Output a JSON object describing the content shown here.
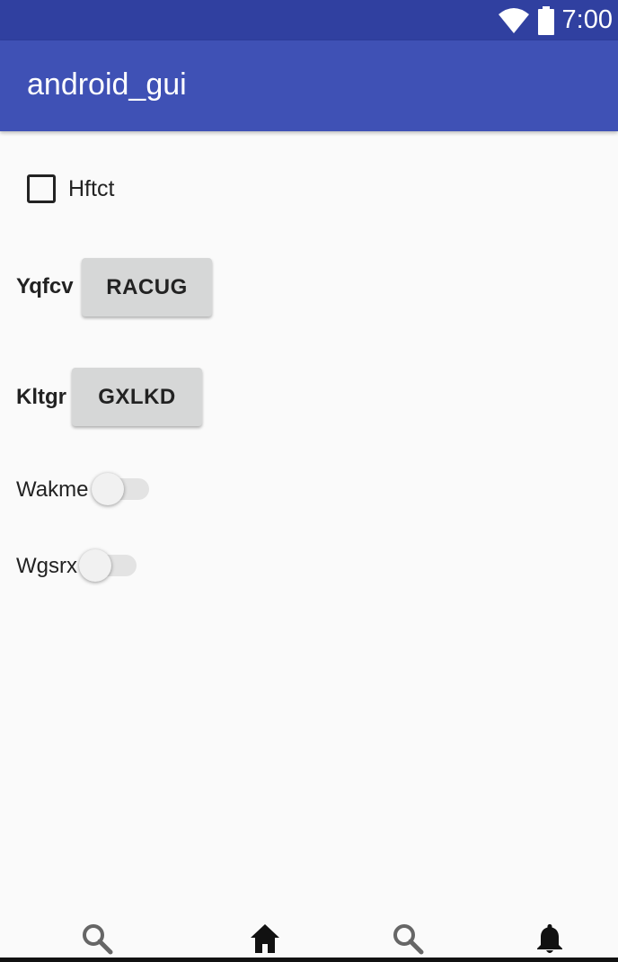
{
  "status_bar": {
    "time": "7:00",
    "icons": [
      "wifi-icon",
      "battery-icon"
    ]
  },
  "app_bar": {
    "title": "android_gui"
  },
  "checkbox": {
    "label": "Hftct",
    "checked": false
  },
  "rows": [
    {
      "label": "Yqfcv",
      "button_label": "RACUG"
    },
    {
      "label": "Kltgr",
      "button_label": "GXLKD"
    }
  ],
  "switches": [
    {
      "label": "Wakme",
      "on": false
    },
    {
      "label": "Wgsrx",
      "on": false
    }
  ],
  "bottom_nav": {
    "icons": [
      "search-icon",
      "home-icon",
      "search-icon",
      "bell-icon"
    ]
  }
}
